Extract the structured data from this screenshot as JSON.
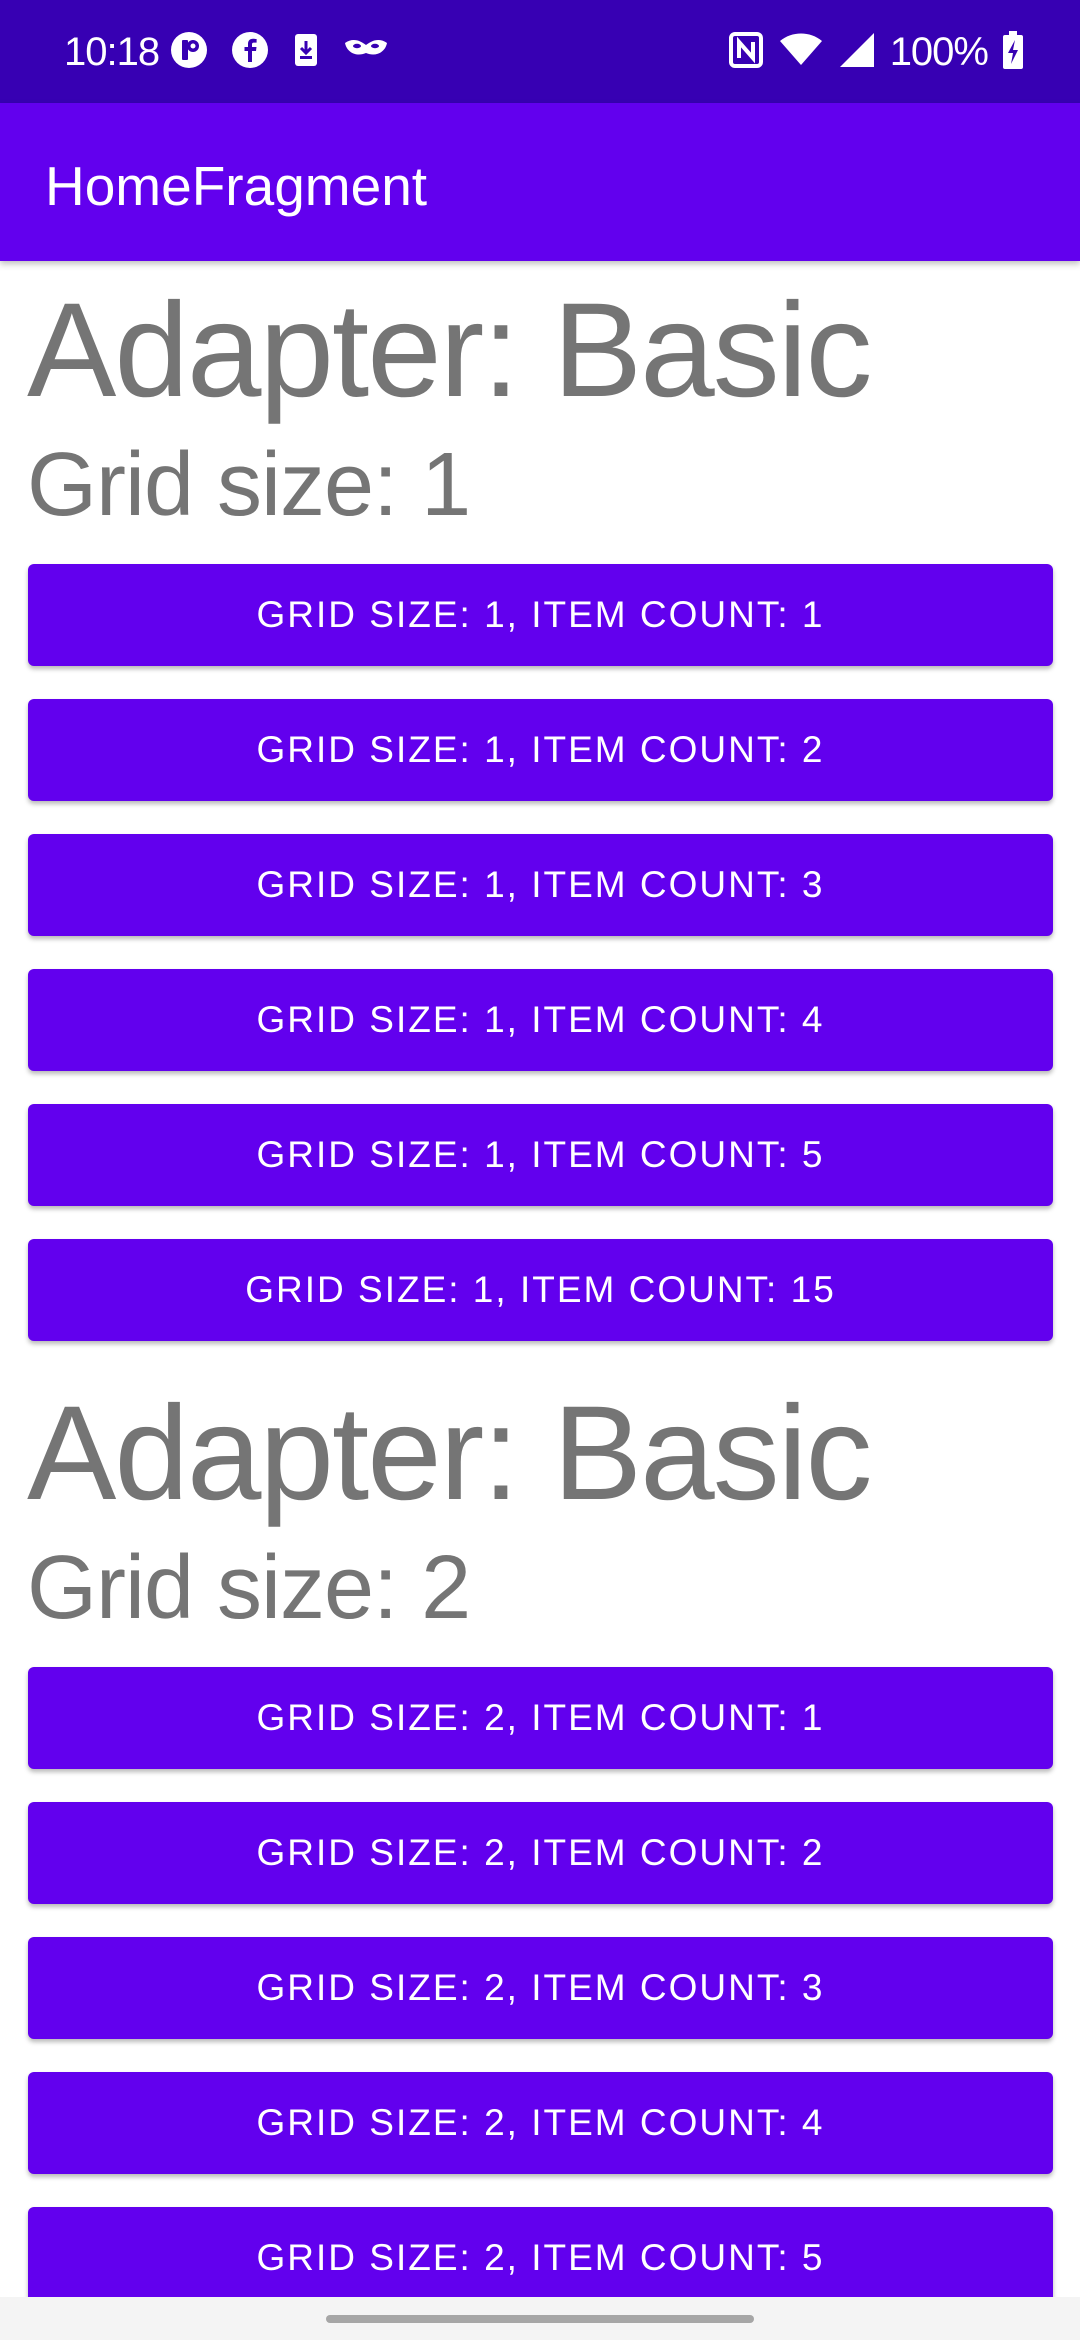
{
  "status_bar": {
    "time": "10:18",
    "left_icons": [
      "app-notification-icon",
      "facebook-icon",
      "download-icon",
      "mask-icon"
    ],
    "right_icons": [
      "nfc-icon",
      "wifi-icon",
      "cellular-signal-icon",
      "battery-charging-icon"
    ],
    "battery_percent": "100%",
    "background_color": "#3700b3"
  },
  "app_bar": {
    "title": "HomeFragment",
    "background_color": "#6200ee"
  },
  "sections": [
    {
      "adapter_label": "Adapter: Basic",
      "grid_label": "Grid size: 1",
      "buttons": [
        "GRID SIZE: 1, ITEM COUNT: 1",
        "GRID SIZE: 1, ITEM COUNT: 2",
        "GRID SIZE: 1, ITEM COUNT: 3",
        "GRID SIZE: 1, ITEM COUNT: 4",
        "GRID SIZE: 1, ITEM COUNT: 5",
        "GRID SIZE: 1, ITEM COUNT: 15"
      ]
    },
    {
      "adapter_label": "Adapter: Basic",
      "grid_label": "Grid size: 2",
      "buttons": [
        "GRID SIZE: 2, ITEM COUNT: 1",
        "GRID SIZE: 2, ITEM COUNT: 2",
        "GRID SIZE: 2, ITEM COUNT: 3",
        "GRID SIZE: 2, ITEM COUNT: 4",
        "GRID SIZE: 2, ITEM COUNT: 5"
      ]
    }
  ],
  "colors": {
    "primary": "#6200ee",
    "primary_dark": "#3700b3",
    "heading_text": "#757575"
  }
}
